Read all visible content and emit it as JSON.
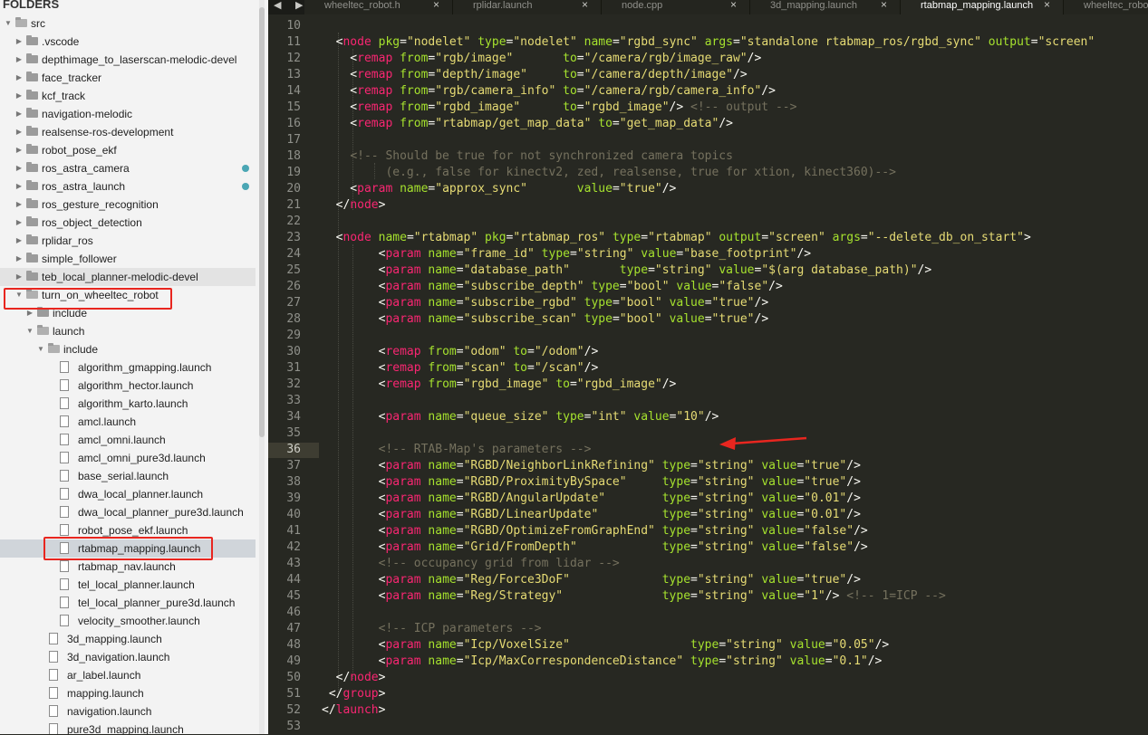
{
  "sidebar": {
    "title": "FOLDERS",
    "items": [
      {
        "label": "src",
        "type": "folder",
        "open": true,
        "level": 0
      },
      {
        "label": ".vscode",
        "type": "folder",
        "open": false,
        "level": 1
      },
      {
        "label": "depthimage_to_laserscan-melodic-devel",
        "type": "folder",
        "open": false,
        "level": 1
      },
      {
        "label": "face_tracker",
        "type": "folder",
        "open": false,
        "level": 1
      },
      {
        "label": "kcf_track",
        "type": "folder",
        "open": false,
        "level": 1
      },
      {
        "label": "navigation-melodic",
        "type": "folder",
        "open": false,
        "level": 1
      },
      {
        "label": "realsense-ros-development",
        "type": "folder",
        "open": false,
        "level": 1
      },
      {
        "label": "robot_pose_ekf",
        "type": "folder",
        "open": false,
        "level": 1
      },
      {
        "label": "ros_astra_camera",
        "type": "folder",
        "open": false,
        "level": 1,
        "modified": true
      },
      {
        "label": "ros_astra_launch",
        "type": "folder",
        "open": false,
        "level": 1,
        "modified": true
      },
      {
        "label": "ros_gesture_recognition",
        "type": "folder",
        "open": false,
        "level": 1
      },
      {
        "label": "ros_object_detection",
        "type": "folder",
        "open": false,
        "level": 1
      },
      {
        "label": "rplidar_ros",
        "type": "folder",
        "open": false,
        "level": 1
      },
      {
        "label": "simple_follower",
        "type": "folder",
        "open": false,
        "level": 1
      },
      {
        "label": "teb_local_planner-melodic-devel",
        "type": "folder",
        "open": false,
        "level": 1,
        "hovered": true
      },
      {
        "label": "turn_on_wheeltec_robot",
        "type": "folder",
        "open": true,
        "level": 1,
        "highlight": true
      },
      {
        "label": "include",
        "type": "folder",
        "open": false,
        "level": 2
      },
      {
        "label": "launch",
        "type": "folder",
        "open": true,
        "level": 2
      },
      {
        "label": "include",
        "type": "folder",
        "open": true,
        "level": 3
      },
      {
        "label": "algorithm_gmapping.launch",
        "type": "file",
        "level": 4
      },
      {
        "label": "algorithm_hector.launch",
        "type": "file",
        "level": 4
      },
      {
        "label": "algorithm_karto.launch",
        "type": "file",
        "level": 4
      },
      {
        "label": "amcl.launch",
        "type": "file",
        "level": 4
      },
      {
        "label": "amcl_omni.launch",
        "type": "file",
        "level": 4
      },
      {
        "label": "amcl_omni_pure3d.launch",
        "type": "file",
        "level": 4
      },
      {
        "label": "base_serial.launch",
        "type": "file",
        "level": 4
      },
      {
        "label": "dwa_local_planner.launch",
        "type": "file",
        "level": 4
      },
      {
        "label": "dwa_local_planner_pure3d.launch",
        "type": "file",
        "level": 4
      },
      {
        "label": "robot_pose_ekf.launch",
        "type": "file",
        "level": 4
      },
      {
        "label": "rtabmap_mapping.launch",
        "type": "file",
        "level": 4,
        "selected": true,
        "highlight": true
      },
      {
        "label": "rtabmap_nav.launch",
        "type": "file",
        "level": 4
      },
      {
        "label": "tel_local_planner.launch",
        "type": "file",
        "level": 4
      },
      {
        "label": "tel_local_planner_pure3d.launch",
        "type": "file",
        "level": 4
      },
      {
        "label": "velocity_smoother.launch",
        "type": "file",
        "level": 4
      },
      {
        "label": "3d_mapping.launch",
        "type": "file",
        "level": 3
      },
      {
        "label": "3d_navigation.launch",
        "type": "file",
        "level": 3
      },
      {
        "label": "ar_label.launch",
        "type": "file",
        "level": 3
      },
      {
        "label": "mapping.launch",
        "type": "file",
        "level": 3
      },
      {
        "label": "navigation.launch",
        "type": "file",
        "level": 3
      },
      {
        "label": "pure3d_mapping.launch",
        "type": "file",
        "level": 3
      }
    ]
  },
  "tabs": {
    "nav_prev": "◀",
    "nav_next": "▶",
    "items": [
      {
        "label": "wheeltec_robot.h",
        "active": false
      },
      {
        "label": "rplidar.launch",
        "active": false
      },
      {
        "label": "node.cpp",
        "active": false
      },
      {
        "label": "3d_mapping.launch",
        "active": false
      },
      {
        "label": "rtabmap_mapping.launch",
        "active": true
      },
      {
        "label": "wheeltec_robot",
        "active": false
      }
    ],
    "close_glyph": "×"
  },
  "editor": {
    "current_line": 36,
    "lines": [
      {
        "n": 10,
        "html": ""
      },
      {
        "n": 11,
        "html": "  <span class='p'>&lt;</span><span class='t'>node</span> <span class='a'>pkg</span>=<span class='s'>\"nodelet\"</span> <span class='a'>type</span>=<span class='s'>\"nodelet\"</span> <span class='a'>name</span>=<span class='s'>\"rgbd_sync\"</span> <span class='a'>args</span>=<span class='s'>\"standalone rtabmap_ros/rgbd_sync\"</span> <span class='a'>output</span>=<span class='s'>\"screen\"</span>"
      },
      {
        "n": 12,
        "html": "    &lt;<span class='t'>remap</span> <span class='a'>from</span>=<span class='s'>\"rgb/image\"</span>       <span class='a'>to</span>=<span class='s'>\"/camera/rgb/image_raw\"</span>/&gt;"
      },
      {
        "n": 13,
        "html": "    &lt;<span class='t'>remap</span> <span class='a'>from</span>=<span class='s'>\"depth/image\"</span>     <span class='a'>to</span>=<span class='s'>\"/camera/depth/image\"</span>/&gt;"
      },
      {
        "n": 14,
        "html": "    &lt;<span class='t'>remap</span> <span class='a'>from</span>=<span class='s'>\"rgb/camera_info\"</span> <span class='a'>to</span>=<span class='s'>\"/camera/rgb/camera_info\"</span>/&gt;"
      },
      {
        "n": 15,
        "html": "    &lt;<span class='t'>remap</span> <span class='a'>from</span>=<span class='s'>\"rgbd_image\"</span>      <span class='a'>to</span>=<span class='s'>\"rgbd_image\"</span>/&gt; <span class='c'>&lt;!-- output --&gt;</span>"
      },
      {
        "n": 16,
        "html": "    &lt;<span class='t'>remap</span> <span class='a'>from</span>=<span class='s'>\"rtabmap/get_map_data\"</span> <span class='a'>to</span>=<span class='s'>\"get_map_data\"</span>/&gt;"
      },
      {
        "n": 17,
        "html": ""
      },
      {
        "n": 18,
        "html": "    <span class='c'>&lt;!-- Should be true for not synchronized camera topics</span>"
      },
      {
        "n": 19,
        "html": "<span class='c'>         (e.g., false for kinectv2, zed, realsense, true for xtion, kinect360)--&gt;</span>"
      },
      {
        "n": 20,
        "html": "    &lt;<span class='t'>param</span> <span class='a'>name</span>=<span class='s'>\"approx_sync\"</span>       <span class='a'>value</span>=<span class='s'>\"true\"</span>/&gt;"
      },
      {
        "n": 21,
        "html": "  &lt;/<span class='t'>node</span>&gt;"
      },
      {
        "n": 22,
        "html": ""
      },
      {
        "n": 23,
        "html": "  &lt;<span class='t'>node</span> <span class='a'>name</span>=<span class='s'>\"rtabmap\"</span> <span class='a'>pkg</span>=<span class='s'>\"rtabmap_ros\"</span> <span class='a'>type</span>=<span class='s'>\"rtabmap\"</span> <span class='a'>output</span>=<span class='s'>\"screen\"</span> <span class='a'>args</span>=<span class='s'>\"--delete_db_on_start\"</span>&gt;"
      },
      {
        "n": 24,
        "html": "        &lt;<span class='t'>param</span> <span class='a'>name</span>=<span class='s'>\"frame_id\"</span> <span class='a'>type</span>=<span class='s'>\"string\"</span> <span class='a'>value</span>=<span class='s'>\"base_footprint\"</span>/&gt;"
      },
      {
        "n": 25,
        "html": "        &lt;<span class='t'>param</span> <span class='a'>name</span>=<span class='s'>\"database_path\"</span>       <span class='a'>type</span>=<span class='s'>\"string\"</span> <span class='a'>value</span>=<span class='s'>\"$(arg database_path)\"</span>/&gt;"
      },
      {
        "n": 26,
        "html": "        &lt;<span class='t'>param</span> <span class='a'>name</span>=<span class='s'>\"subscribe_depth\"</span> <span class='a'>type</span>=<span class='s'>\"bool\"</span> <span class='a'>value</span>=<span class='s'>\"false\"</span>/&gt;"
      },
      {
        "n": 27,
        "html": "        &lt;<span class='t'>param</span> <span class='a'>name</span>=<span class='s'>\"subscribe_rgbd\"</span> <span class='a'>type</span>=<span class='s'>\"bool\"</span> <span class='a'>value</span>=<span class='s'>\"true\"</span>/&gt;"
      },
      {
        "n": 28,
        "html": "        &lt;<span class='t'>param</span> <span class='a'>name</span>=<span class='s'>\"subscribe_scan\"</span> <span class='a'>type</span>=<span class='s'>\"bool\"</span> <span class='a'>value</span>=<span class='s'>\"true\"</span>/&gt;"
      },
      {
        "n": 29,
        "html": ""
      },
      {
        "n": 30,
        "html": "        &lt;<span class='t'>remap</span> <span class='a'>from</span>=<span class='s'>\"odom\"</span> <span class='a'>to</span>=<span class='s'>\"/odom\"</span>/&gt;"
      },
      {
        "n": 31,
        "html": "        &lt;<span class='t'>remap</span> <span class='a'>from</span>=<span class='s'>\"scan\"</span> <span class='a'>to</span>=<span class='s'>\"/scan\"</span>/&gt;"
      },
      {
        "n": 32,
        "html": "        &lt;<span class='t'>remap</span> <span class='a'>from</span>=<span class='s'>\"rgbd_image\"</span> <span class='a'>to</span>=<span class='s'>\"rgbd_image\"</span>/&gt;"
      },
      {
        "n": 33,
        "html": ""
      },
      {
        "n": 34,
        "html": "        &lt;<span class='t'>param</span> <span class='a'>name</span>=<span class='s'>\"queue_size\"</span> <span class='a'>type</span>=<span class='s'>\"int\"</span> <span class='a'>value</span>=<span class='s'>\"10\"</span>/&gt;"
      },
      {
        "n": 35,
        "html": ""
      },
      {
        "n": 36,
        "html": "        <span class='c'>&lt;!-- RTAB-Map's parameters --&gt;</span>"
      },
      {
        "n": 37,
        "html": "        &lt;<span class='t'>param</span> <span class='a'>name</span>=<span class='s'>\"RGBD/NeighborLinkRefining\"</span> <span class='a'>type</span>=<span class='s'>\"string\"</span> <span class='a'>value</span>=<span class='s'>\"true\"</span>/&gt;"
      },
      {
        "n": 38,
        "html": "        &lt;<span class='t'>param</span> <span class='a'>name</span>=<span class='s'>\"RGBD/ProximityBySpace\"</span>     <span class='a'>type</span>=<span class='s'>\"string\"</span> <span class='a'>value</span>=<span class='s'>\"true\"</span>/&gt;"
      },
      {
        "n": 39,
        "html": "        &lt;<span class='t'>param</span> <span class='a'>name</span>=<span class='s'>\"RGBD/AngularUpdate\"</span>        <span class='a'>type</span>=<span class='s'>\"string\"</span> <span class='a'>value</span>=<span class='s'>\"0.01\"</span>/&gt;"
      },
      {
        "n": 40,
        "html": "        &lt;<span class='t'>param</span> <span class='a'>name</span>=<span class='s'>\"RGBD/LinearUpdate\"</span>         <span class='a'>type</span>=<span class='s'>\"string\"</span> <span class='a'>value</span>=<span class='s'>\"0.01\"</span>/&gt;"
      },
      {
        "n": 41,
        "html": "        &lt;<span class='t'>param</span> <span class='a'>name</span>=<span class='s'>\"RGBD/OptimizeFromGraphEnd\"</span> <span class='a'>type</span>=<span class='s'>\"string\"</span> <span class='a'>value</span>=<span class='s'>\"false\"</span>/&gt;"
      },
      {
        "n": 42,
        "html": "        &lt;<span class='t'>param</span> <span class='a'>name</span>=<span class='s'>\"Grid/FromDepth\"</span>            <span class='a'>type</span>=<span class='s'>\"string\"</span> <span class='a'>value</span>=<span class='s'>\"false\"</span>/&gt;"
      },
      {
        "n": 43,
        "html": "        <span class='c'>&lt;!-- occupancy grid from lidar --&gt;</span>"
      },
      {
        "n": 44,
        "html": "        &lt;<span class='t'>param</span> <span class='a'>name</span>=<span class='s'>\"Reg/Force3DoF\"</span>             <span class='a'>type</span>=<span class='s'>\"string\"</span> <span class='a'>value</span>=<span class='s'>\"true\"</span>/&gt;"
      },
      {
        "n": 45,
        "html": "        &lt;<span class='t'>param</span> <span class='a'>name</span>=<span class='s'>\"Reg/Strategy\"</span>              <span class='a'>type</span>=<span class='s'>\"string\"</span> <span class='a'>value</span>=<span class='s'>\"1\"</span>/&gt; <span class='c'>&lt;!-- 1=ICP --&gt;</span>"
      },
      {
        "n": 46,
        "html": ""
      },
      {
        "n": 47,
        "html": "        <span class='c'>&lt;!-- ICP parameters --&gt;</span>"
      },
      {
        "n": 48,
        "html": "        &lt;<span class='t'>param</span> <span class='a'>name</span>=<span class='s'>\"Icp/VoxelSize\"</span>                 <span class='a'>type</span>=<span class='s'>\"string\"</span> <span class='a'>value</span>=<span class='s'>\"0.05\"</span>/&gt;"
      },
      {
        "n": 49,
        "html": "        &lt;<span class='t'>param</span> <span class='a'>name</span>=<span class='s'>\"Icp/MaxCorrespondenceDistance\"</span> <span class='a'>type</span>=<span class='s'>\"string\"</span> <span class='a'>value</span>=<span class='s'>\"0.1\"</span>/&gt;"
      },
      {
        "n": 50,
        "html": "  &lt;/<span class='t'>node</span>&gt;"
      },
      {
        "n": 51,
        "html": " &lt;/<span class='t'>group</span>&gt;"
      },
      {
        "n": 52,
        "html": "&lt;/<span class='t'>launch</span>&gt;"
      },
      {
        "n": 53,
        "html": ""
      }
    ]
  },
  "colors": {
    "annotation_red": "#e8261f",
    "editor_bg": "#272822",
    "tag": "#f92672",
    "attr": "#a6e22e",
    "string": "#e6db74",
    "comment": "#75715e"
  }
}
